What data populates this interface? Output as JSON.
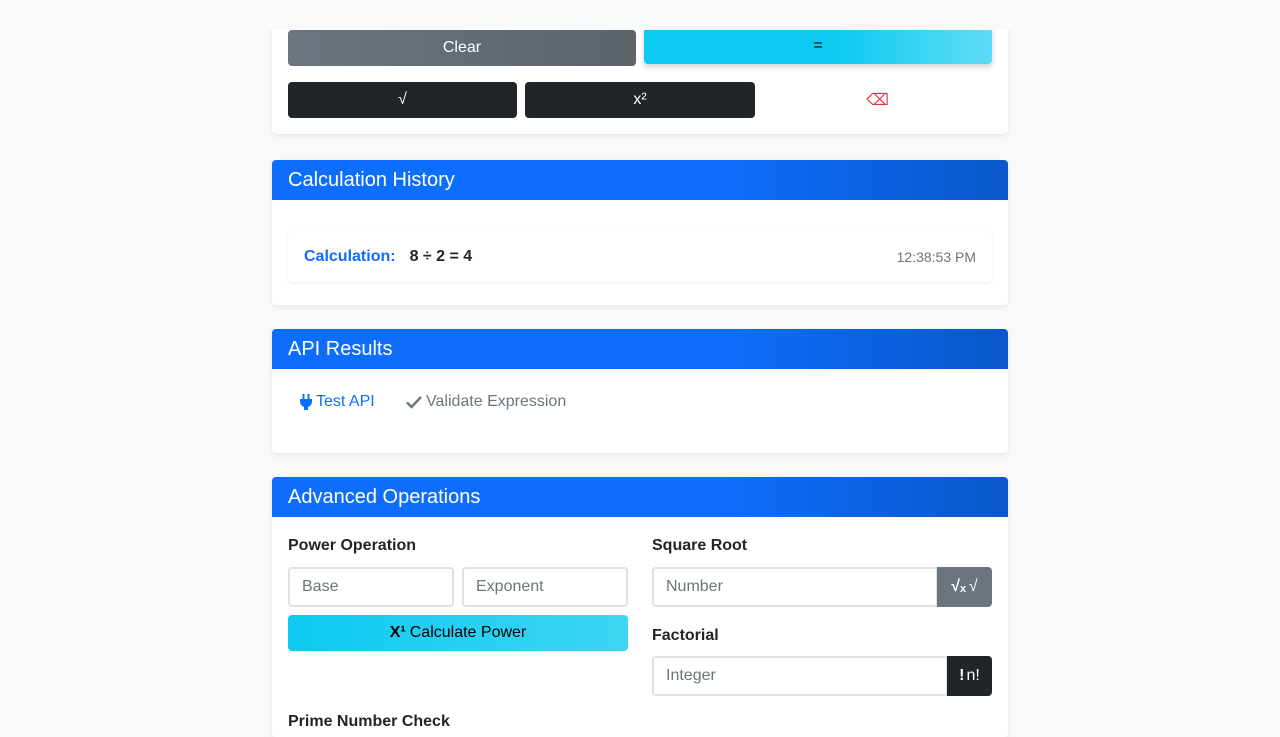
{
  "keypad": {
    "clear_label": "Clear",
    "equals_label": "=",
    "sqrt_label": "√",
    "square_label": "x²",
    "backspace_label": "⌫"
  },
  "history": {
    "title": "Calculation History",
    "items": [
      {
        "label": "Calculation:",
        "expression": "8 ÷ 2 = 4",
        "time": "12:38:53 PM"
      }
    ]
  },
  "api": {
    "title": "API Results",
    "test_label": "Test API",
    "validate_label": "Validate Expression"
  },
  "advanced": {
    "title": "Advanced Operations",
    "power": {
      "label": "Power Operation",
      "base_placeholder": "Base",
      "exponent_placeholder": "Exponent",
      "button_label": "Calculate Power"
    },
    "sqrt": {
      "label": "Square Root",
      "placeholder": "Number",
      "button_label": "√"
    },
    "factorial": {
      "label": "Factorial",
      "placeholder": "Integer",
      "button_label": "n!"
    },
    "prime_label": "Prime Number Check"
  },
  "colors": {
    "primary": "#0d6efd",
    "info": "#0dcaf0",
    "dark": "#212529",
    "secondary": "#6c757d",
    "danger": "#dc3545"
  }
}
